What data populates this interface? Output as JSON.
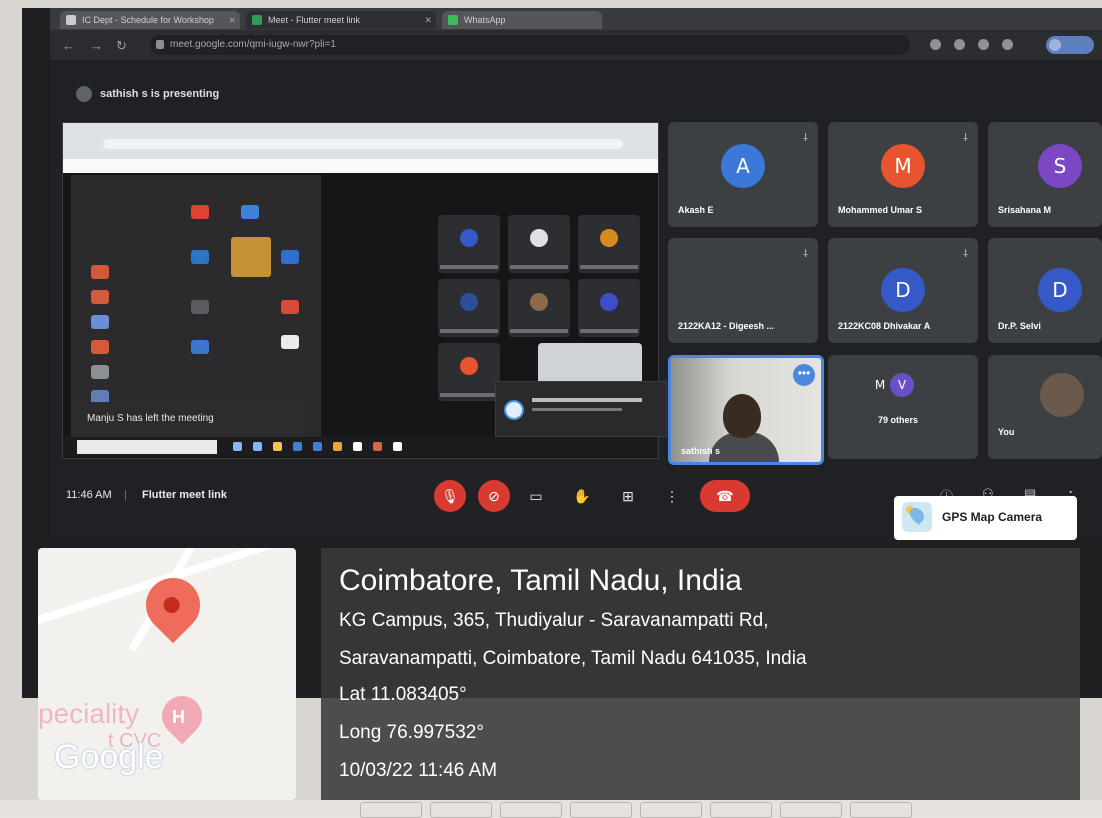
{
  "browser": {
    "tabs": [
      {
        "label": "IC Dept - Schedule for Workshop"
      },
      {
        "label": "Meet - Flutter meet link"
      },
      {
        "label": "WhatsApp"
      }
    ],
    "url": "meet.google.com/qmi-iugw-nwr?pli=1"
  },
  "meet": {
    "presenting_text": "sathish s is presenting",
    "toast": "Manju S has left the meeting",
    "time": "11:46 AM",
    "separator": "|",
    "meeting_name": "Flutter meet link",
    "participants": [
      {
        "initial": "A",
        "name": "Akash E",
        "color": "#3b78d8"
      },
      {
        "initial": "M",
        "name": "Mohammed Umar S",
        "color": "#e8542f"
      },
      {
        "initial": "S",
        "name": "Srisahana M",
        "color": "#7c47c2"
      },
      {
        "initial": "",
        "name": "2122KA12 - Digeesh ...",
        "color": ""
      },
      {
        "initial": "D",
        "name": "2122KC08 Dhivakar A",
        "color": "#3559c7"
      },
      {
        "initial": "D",
        "name": "Dr.P. Selvi",
        "color": "#3559c7"
      }
    ],
    "others": {
      "initials": [
        "M",
        "V"
      ],
      "label": "79 others"
    },
    "you_label": "You",
    "self_name": "sathish s"
  },
  "overlay": {
    "app_name": "GPS Map Camera",
    "city": "Coimbatore, Tamil Nadu, India",
    "address_line1": "KG Campus, 365, Thudiyalur - Saravanampatti Rd,",
    "address_line2": "Saravanampatti, Coimbatore, Tamil Nadu 641035, India",
    "lat": "Lat 11.083405°",
    "long": "Long 76.997532°",
    "datetime": "10/03/22 11:46 AM",
    "map_text_speciality": "peciality",
    "map_text_cvc": "t CVC",
    "map_google": "Google"
  },
  "icons": {
    "mic_off": "mic-off-icon",
    "cam_off": "camera-off-icon",
    "captions": "captions-icon",
    "raise_hand": "hand-icon",
    "present": "present-icon",
    "more": "more-icon",
    "end_call": "end-call-icon"
  }
}
